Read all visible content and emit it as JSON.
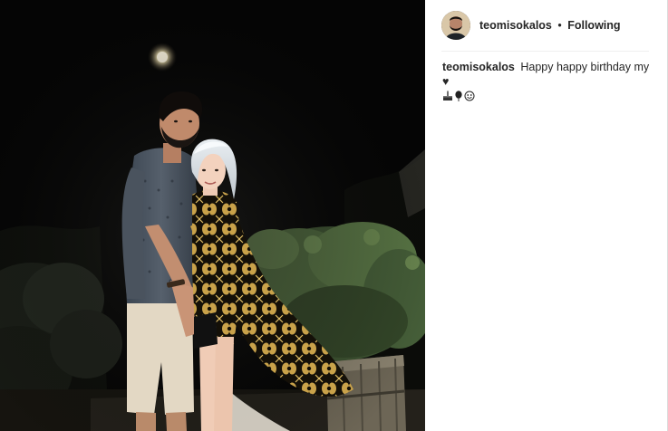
{
  "post": {
    "username": "teomisokalos",
    "separator": "•",
    "follow_status": "Following"
  },
  "caption": {
    "username": "teomisokalos",
    "text": "Happy happy birthday my ♥"
  },
  "icons": {
    "avatar": "profile-avatar",
    "caption_emojis": [
      "birthday-cake-icon",
      "balloon-icon",
      "face-icon"
    ]
  },
  "colors": {
    "text": "#262626",
    "divider": "#efefef",
    "border": "#dbdbdb",
    "photo_background": "#050505"
  }
}
